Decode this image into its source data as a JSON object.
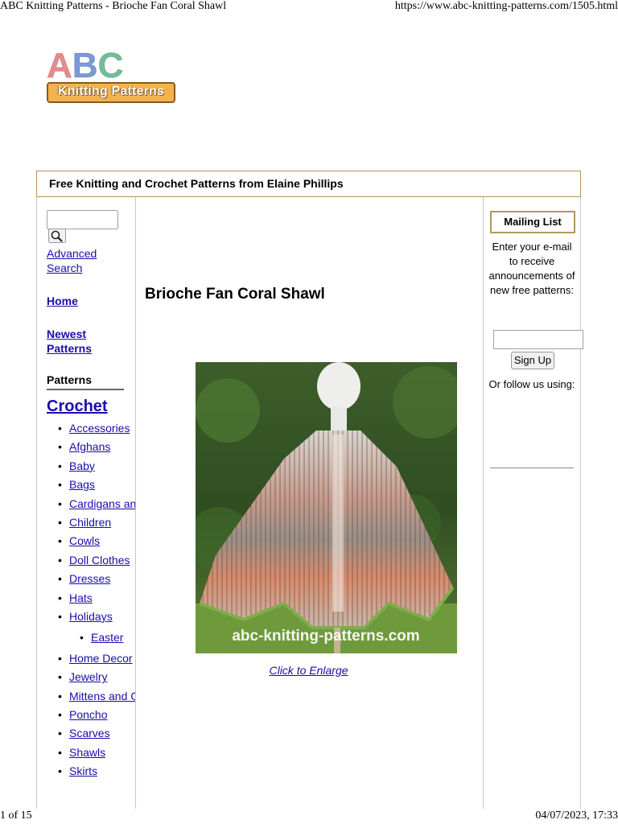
{
  "print_header": {
    "page_title": "ABC Knitting Patterns - Brioche Fan Coral Shawl",
    "url": "https://www.abc-knitting-patterns.com/1505.html"
  },
  "print_footer": {
    "page_count": "1 of 15",
    "date_time": "04/07/2023, 17:33"
  },
  "logo": {
    "letters": [
      "A",
      "B",
      "C"
    ],
    "tagline": "Knitting Patterns"
  },
  "banner": {
    "title": "Free Knitting and Crochet Patterns from Elaine Phillips"
  },
  "sidebar": {
    "search_placeholder": "",
    "advanced_search": "Advanced Search",
    "home": "Home",
    "newest_patterns": "Newest Patterns",
    "patterns_label": "Patterns",
    "crochet_heading": "Crochet",
    "categories": [
      {
        "label": "Accessories",
        "level": 1
      },
      {
        "label": "Afghans",
        "level": 1
      },
      {
        "label": "Baby",
        "level": 1
      },
      {
        "label": "Bags",
        "level": 1
      },
      {
        "label": "Cardigans and",
        "level": 1
      },
      {
        "label": "Children",
        "level": 1
      },
      {
        "label": "Cowls",
        "level": 1
      },
      {
        "label": "Doll Clothes",
        "level": 1
      },
      {
        "label": "Dresses",
        "level": 1
      },
      {
        "label": "Hats",
        "level": 1
      },
      {
        "label": "Holidays",
        "level": 1
      },
      {
        "label": "Easter",
        "level": 2
      },
      {
        "label": "Home Decor",
        "level": 1
      },
      {
        "label": "Jewelry",
        "level": 1
      },
      {
        "label": "Mittens and G",
        "level": 1
      },
      {
        "label": "Poncho",
        "level": 1
      },
      {
        "label": "Scarves",
        "level": 1
      },
      {
        "label": "Shawls",
        "level": 1
      },
      {
        "label": "Skirts",
        "level": 1
      }
    ]
  },
  "main": {
    "pattern_title": "Brioche Fan Coral Shawl",
    "photo_watermark": "abc-knitting-patterns.com",
    "enlarge_link": "Click to Enlarge"
  },
  "mailing": {
    "title": "Mailing List",
    "description": "Enter your e-mail to receive announcements of new free patterns:",
    "email_placeholder": "",
    "signup_label": "Sign Up",
    "follow_text": "Or follow us using:"
  },
  "colors": {
    "link": "#1a0dab",
    "box_border": "#b5975d",
    "logo_a": "#e88a8a",
    "logo_b": "#7a9ad8",
    "logo_c": "#6fbf96",
    "logo_banner": "#f4b24f"
  }
}
